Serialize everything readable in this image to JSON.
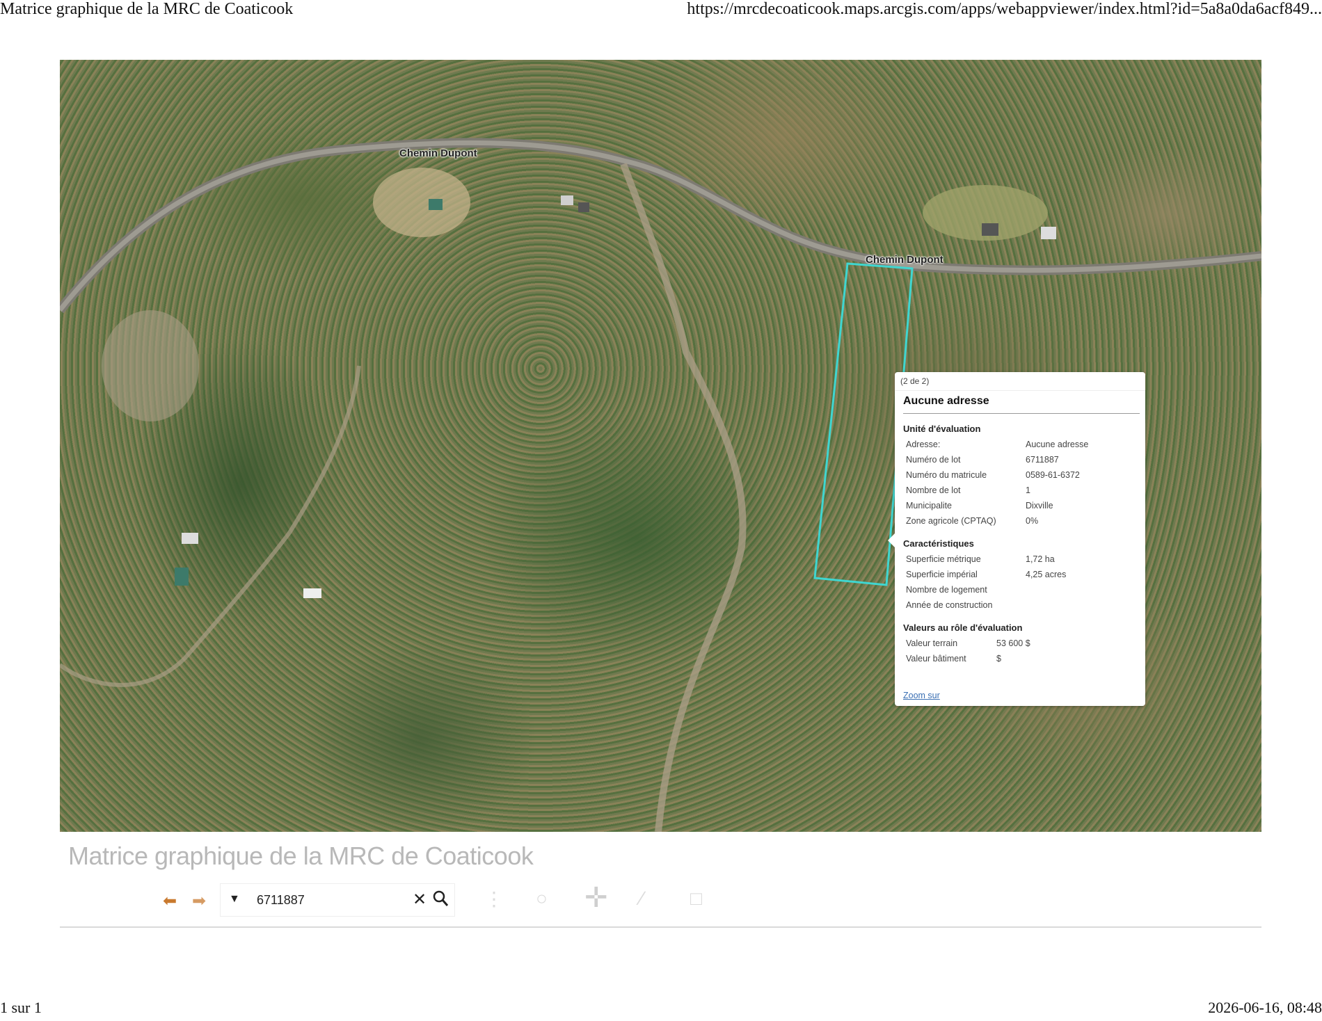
{
  "print_header": {
    "title": "Matrice graphique de la MRC de Coaticook",
    "url": "https://mrcdecoaticook.maps.arcgis.com/apps/webappviewer/index.html?id=5a8a0da6acf849..."
  },
  "print_footer": {
    "page": "1 sur 1",
    "datetime": "2026-06-16, 08:48"
  },
  "map": {
    "road_labels": [
      "Chemin Dupont",
      "Chemin Dupont"
    ],
    "parcel_color": "#3fd6d0"
  },
  "popup": {
    "pager": "(2 de 2)",
    "title": "Aucune adresse",
    "section_unite": "Unité d'évaluation",
    "unite_rows": [
      {
        "k": "Adresse:",
        "v": "Aucune adresse"
      },
      {
        "k": "Numéro de lot",
        "v": "6711887"
      },
      {
        "k": "Numéro du matricule",
        "v": "0589-61-6372"
      },
      {
        "k": "Nombre de lot",
        "v": "1"
      },
      {
        "k": "Municipalite",
        "v": "Dixville"
      },
      {
        "k": "Zone agricole (CPTAQ)",
        "v": "0%"
      }
    ],
    "section_caracteristiques": "Caractéristiques",
    "carac_rows": [
      {
        "k": "Superficie métrique",
        "v": "1,72 ha"
      },
      {
        "k": "Superficie impérial",
        "v": "4,25 acres"
      },
      {
        "k": "Nombre de logement",
        "v": ""
      },
      {
        "k": "Année de construction",
        "v": ""
      }
    ],
    "section_valeurs": "Valeurs au rôle d'évaluation",
    "valeur_rows": [
      {
        "k": "Valeur terrain",
        "v": "53 600 $"
      },
      {
        "k": "Valeur bâtiment",
        "v": "$"
      }
    ],
    "zoom_link": "Zoom sur"
  },
  "app": {
    "title": "Matrice graphique de la MRC de Coaticook"
  },
  "toolbar": {
    "back_icon": "arrow-left-icon",
    "forward_icon": "arrow-right-icon",
    "search_value": "6711887",
    "accent_color": "#c97a2f"
  }
}
